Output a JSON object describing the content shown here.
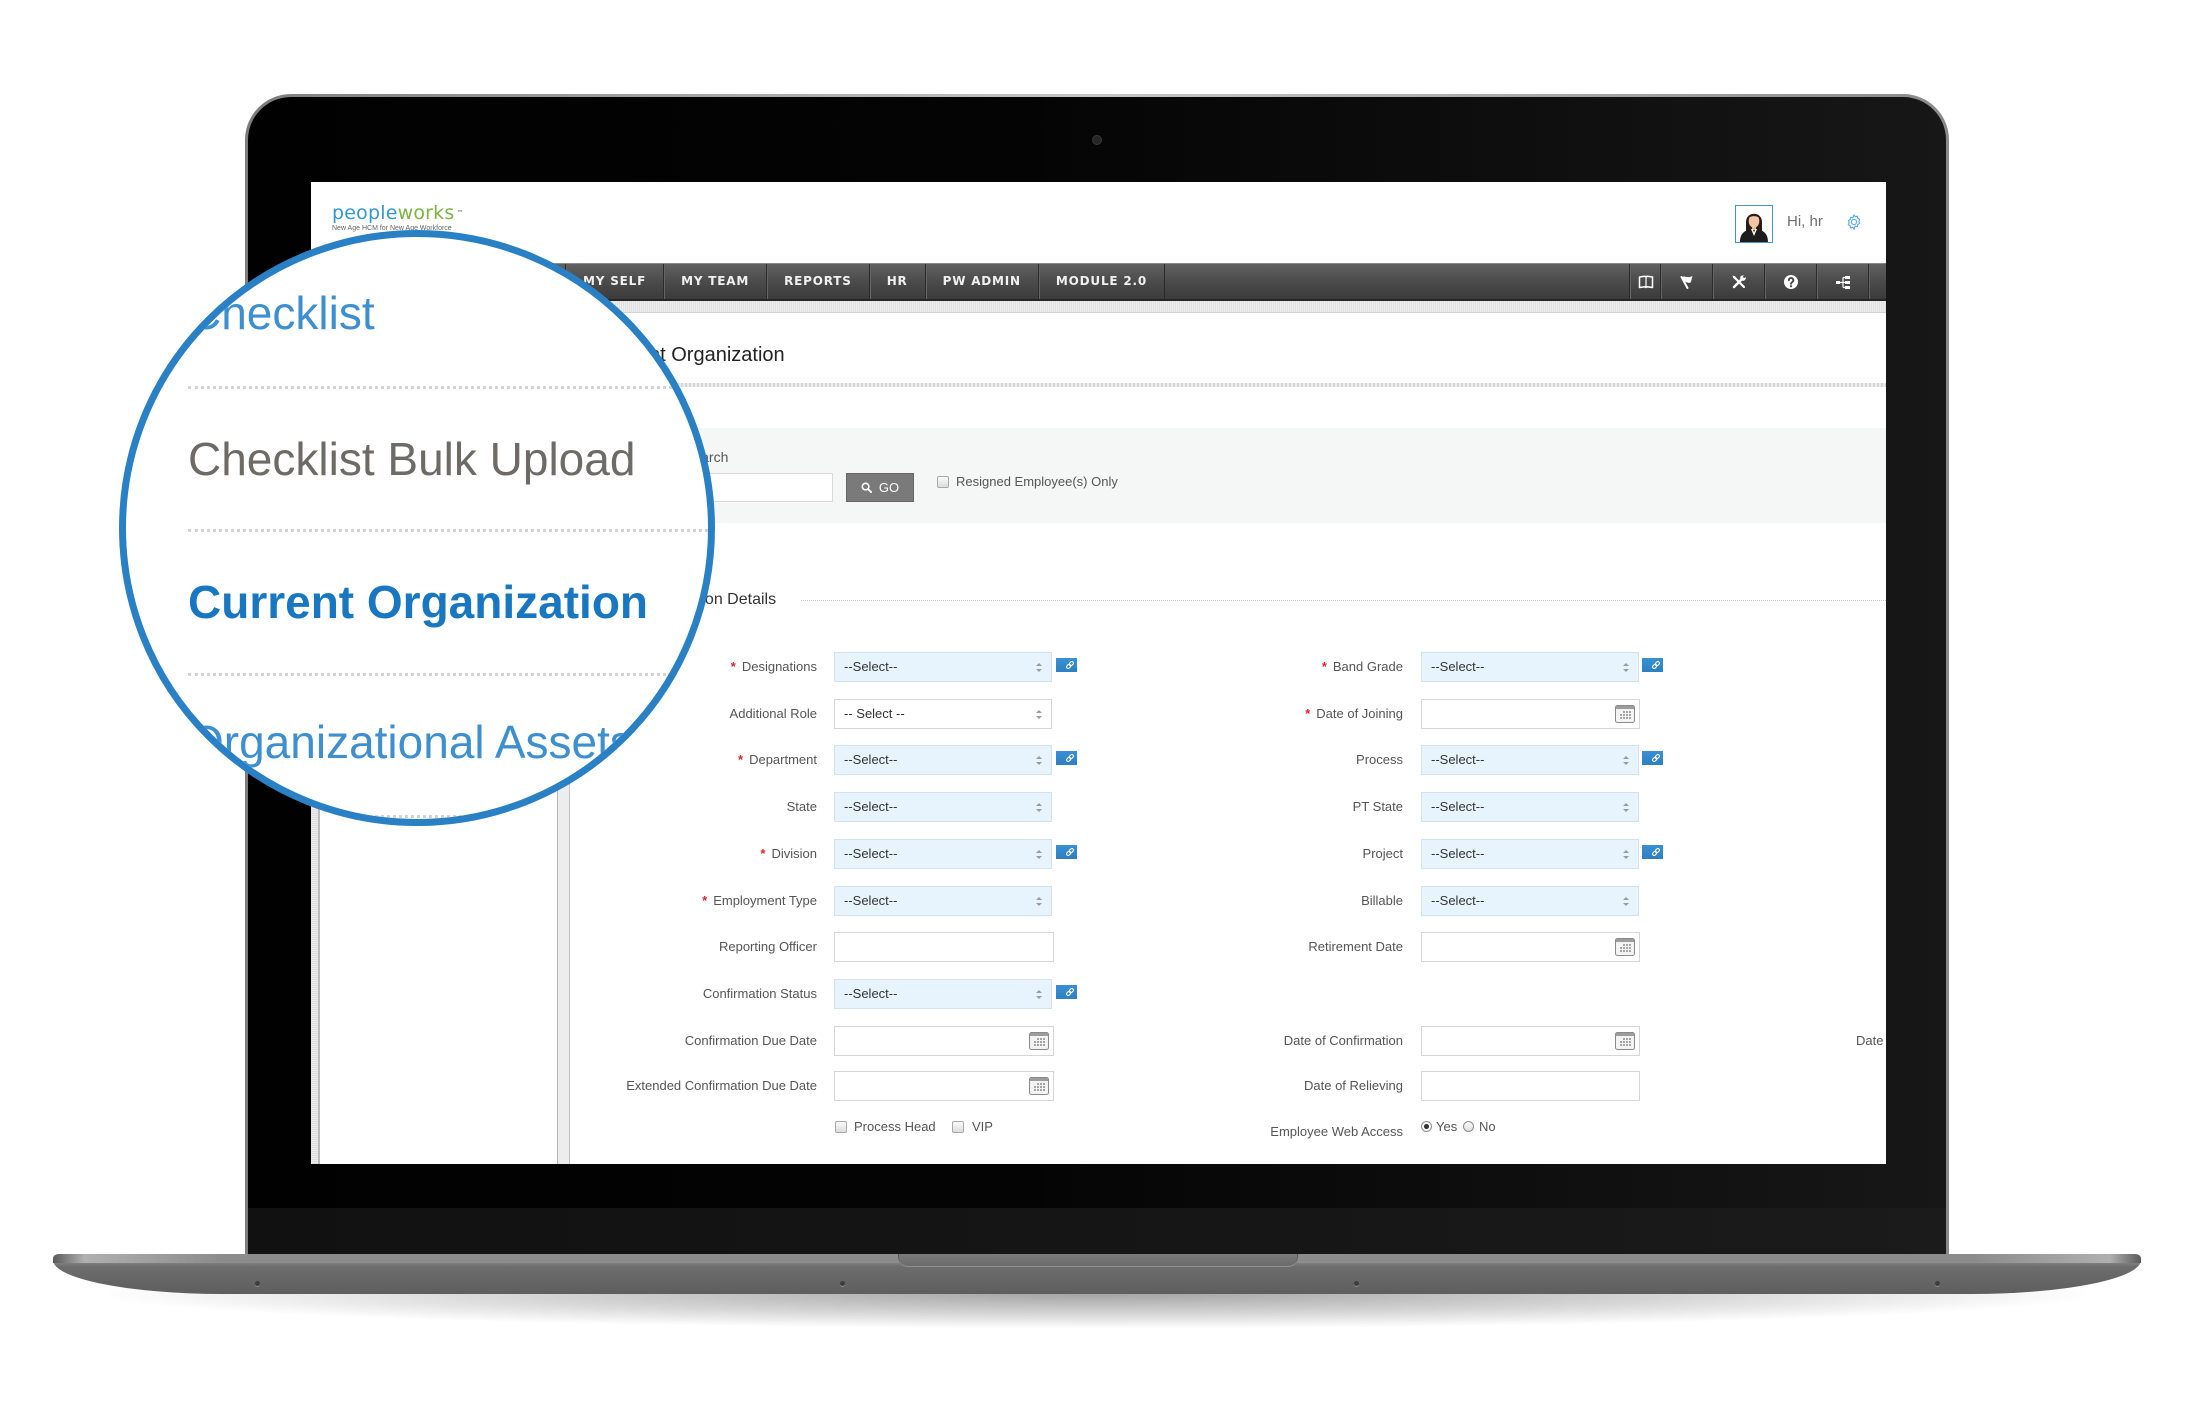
{
  "colors": {
    "accent": "#2a80c4",
    "brand_blue": "#3399cc",
    "brand_green": "#7cb342",
    "required": "#d9232d",
    "select_bg": "#e8f4fd",
    "link_button": "#2d7fc1",
    "go_button": "#7a7a7a",
    "mag_link": "#3d8fd0",
    "mag_active": "#1877c0",
    "mag_muted": "#6e6a66"
  },
  "header": {
    "logo_part1": "people",
    "logo_part2": "works",
    "logo_tm": "™",
    "tagline": "New Age HCM for New Age Workforce",
    "avatar_icon": "user-avatar-icon",
    "greeting": "Hi, hr",
    "settings_icon": "gear-icon"
  },
  "nav": {
    "items": [
      {
        "label": "MY SELF"
      },
      {
        "label": "MY TEAM"
      },
      {
        "label": "REPORTS"
      },
      {
        "label": "HR"
      },
      {
        "label": "PW ADMIN"
      },
      {
        "label": "MODULE 2.0"
      }
    ],
    "tools": [
      {
        "icon": "book-open-icon"
      },
      {
        "icon": "flag-icon"
      },
      {
        "icon": "tools-icon"
      },
      {
        "icon": "help-icon"
      },
      {
        "icon": "sitemap-icon"
      }
    ]
  },
  "magnifier": {
    "items": [
      {
        "label": "Checklist",
        "active": false
      },
      {
        "label": "Checklist Bulk Upload",
        "active": false
      },
      {
        "label": "Current Organization",
        "active": true
      },
      {
        "label": "Organizational Assets",
        "active": false
      }
    ]
  },
  "page": {
    "title": "Current Organization"
  },
  "search": {
    "label": "Search",
    "value": "",
    "go_label": "GO",
    "resigned_only_label": "Resigned Employee(s) Only",
    "resigned_only_checked": false
  },
  "section": {
    "title": "Organization Details"
  },
  "form": {
    "required_marker": "*",
    "left": [
      {
        "label": "Designations",
        "required": true,
        "type": "select",
        "value": "--Select--",
        "link": true
      },
      {
        "label": "Additional Role",
        "required": false,
        "type": "select",
        "value": "-- Select --",
        "link": false
      },
      {
        "label": "Department",
        "required": true,
        "type": "select",
        "value": "--Select--",
        "link": true
      },
      {
        "label": "State",
        "required": false,
        "type": "select",
        "value": "--Select--",
        "link": false
      },
      {
        "label": "Division",
        "required": true,
        "type": "select",
        "value": "--Select--",
        "link": true
      },
      {
        "label": "Employment Type",
        "required": true,
        "type": "select",
        "value": "--Select--",
        "link": false
      },
      {
        "label": "Reporting Officer",
        "required": false,
        "type": "text",
        "value": ""
      },
      {
        "label": "Confirmation Status",
        "required": false,
        "type": "select",
        "value": "--Select--",
        "link": true
      },
      {
        "label": "Confirmation Due Date",
        "required": false,
        "type": "date",
        "value": ""
      },
      {
        "label": "Extended Confirmation Due Date",
        "required": false,
        "type": "date",
        "value": ""
      }
    ],
    "right": [
      {
        "label": "Band Grade",
        "required": true,
        "type": "select",
        "value": "--Select--",
        "link": true
      },
      {
        "label": "Date of Joining",
        "required": true,
        "type": "date",
        "value": ""
      },
      {
        "label": "Process",
        "required": false,
        "type": "select",
        "value": "--Select--",
        "link": true
      },
      {
        "label": "PT State",
        "required": false,
        "type": "select",
        "value": "--Select--",
        "link": false
      },
      {
        "label": "Project",
        "required": false,
        "type": "select",
        "value": "--Select--",
        "link": true
      },
      {
        "label": "Billable",
        "required": false,
        "type": "select",
        "value": "--Select--",
        "link": false
      },
      {
        "label": "Retirement Date",
        "required": false,
        "type": "date",
        "value": ""
      },
      {
        "label": "Date of Confirmation",
        "required": false,
        "type": "date",
        "value": ""
      },
      {
        "label": "Date of Relieving",
        "required": false,
        "type": "text",
        "value": ""
      }
    ],
    "flags": [
      {
        "label": "Process Head",
        "checked": false
      },
      {
        "label": "VIP",
        "checked": false
      }
    ],
    "web_access": {
      "label": "Employee Web Access",
      "options": [
        {
          "label": "Yes",
          "checked": true
        },
        {
          "label": "No",
          "checked": false
        }
      ]
    },
    "overflow_label": "Date"
  }
}
